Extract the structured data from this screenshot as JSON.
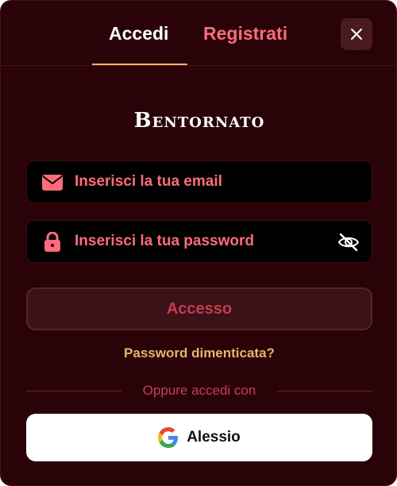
{
  "tabs": {
    "login": "Accedi",
    "register": "Registrati"
  },
  "heading": "Bentornato",
  "email": {
    "placeholder": "Inserisci la tua email",
    "icon": "envelope-icon"
  },
  "password": {
    "placeholder": "Inserisci la tua password",
    "icon": "lock-icon",
    "toggle_icon": "eye-slash-icon"
  },
  "submit_label": "Accesso",
  "forgot_label": "Password dimenticata?",
  "divider_text": "Oppure accedi con",
  "google": {
    "name": "Alessio",
    "icon": "google-icon"
  },
  "colors": {
    "background": "#2a0309",
    "accent_gold": "#e6b56a",
    "accent_red": "#ff6b7b",
    "inactive_tab": "#f76c7a"
  }
}
